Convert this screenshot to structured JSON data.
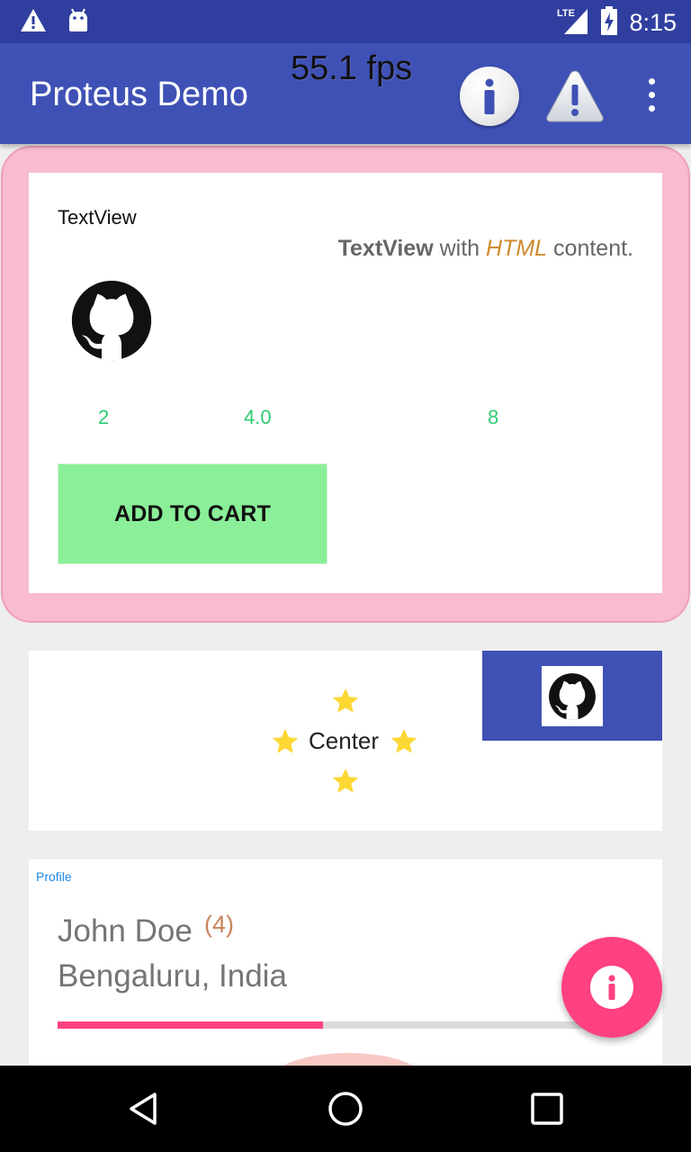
{
  "status_bar": {
    "time": "8:15",
    "network": "LTE",
    "icons": [
      "warning-icon",
      "android-debug-icon",
      "signal-icon",
      "battery-charging-icon"
    ]
  },
  "app_bar": {
    "title": "Proteus Demo",
    "fps": "55.1 fps",
    "actions": [
      "info-icon",
      "warning-icon",
      "more-vert-icon"
    ]
  },
  "card1": {
    "plain_text": "TextView",
    "html_text": {
      "bold": "TextView",
      "middle": " with ",
      "italic": "HTML",
      "end": " content."
    },
    "numbers": [
      "2",
      "4.0",
      "8"
    ],
    "button_label": "ADD TO CART",
    "colors": {
      "frame": "#f8bbd0",
      "button": "#8aef98",
      "numbers": "#2ecc71"
    }
  },
  "card2": {
    "center_label": "Center",
    "star_color": "#fdd835",
    "block_color": "#3f51b5"
  },
  "card3": {
    "section_label": "Profile",
    "name": "John Doe",
    "count": "(4)",
    "location": "Bengaluru, India",
    "progress": 0.5
  },
  "fab": {
    "icon": "info-icon",
    "color": "#ff4081"
  },
  "nav_bar": {
    "buttons": [
      "back-icon",
      "home-icon",
      "recents-icon"
    ]
  },
  "colors": {
    "primary": "#3f51b5",
    "primary_dark": "#303f9f",
    "accent": "#ff4081"
  }
}
